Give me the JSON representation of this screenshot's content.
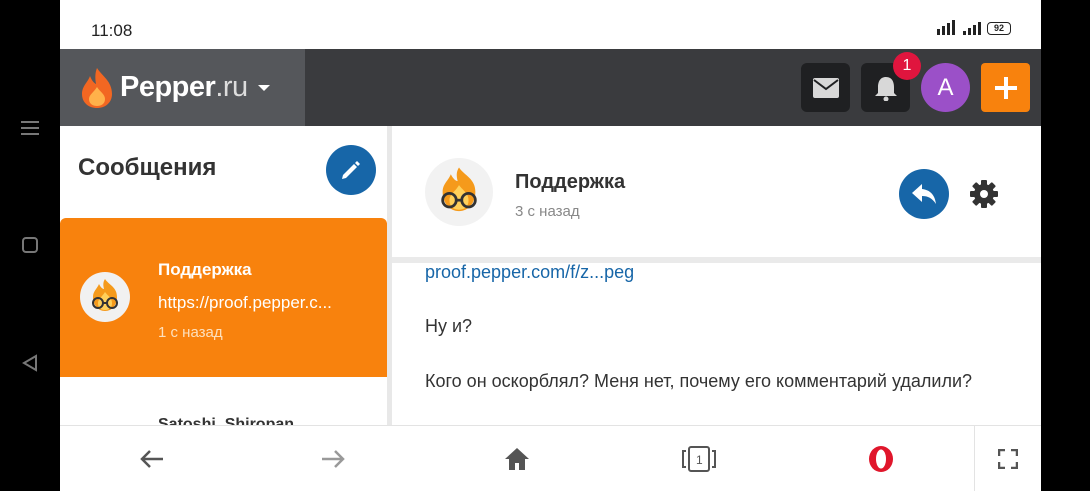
{
  "status": {
    "time": "11:08",
    "battery": "92"
  },
  "header": {
    "brand_name": "Pepper",
    "brand_tld": ".ru",
    "notif_count": "1",
    "avatar_letter": "A"
  },
  "left": {
    "title": "Сообщения",
    "conversations": [
      {
        "name": "Поддержка",
        "preview": "https://proof.pepper.c...",
        "time": "1 с назад"
      },
      {
        "name": "Satoshi_Shiropan"
      }
    ]
  },
  "right": {
    "name": "Поддержка",
    "time": "3 с назад",
    "messages": [
      "proof.pepper.com/f/z...peg",
      "Ну и?",
      "Кого он оскорблял? Меня нет, почему его комментарий удалили?"
    ]
  },
  "colors": {
    "accent": "#f8820d",
    "header_bg": "#3a3b3e",
    "blue": "#1766a8",
    "badge": "#e0153e",
    "avatar": "#9b50c8"
  },
  "icons": [
    "menu-icon",
    "square-icon",
    "back-triangle-icon",
    "signal-icon",
    "mail-icon",
    "bell-icon",
    "plus-icon",
    "pencil-icon",
    "reply-icon",
    "gear-icon",
    "arrow-left-icon",
    "arrow-right-icon",
    "home-icon",
    "tabs-icon",
    "opera-icon",
    "fullscreen-icon"
  ]
}
